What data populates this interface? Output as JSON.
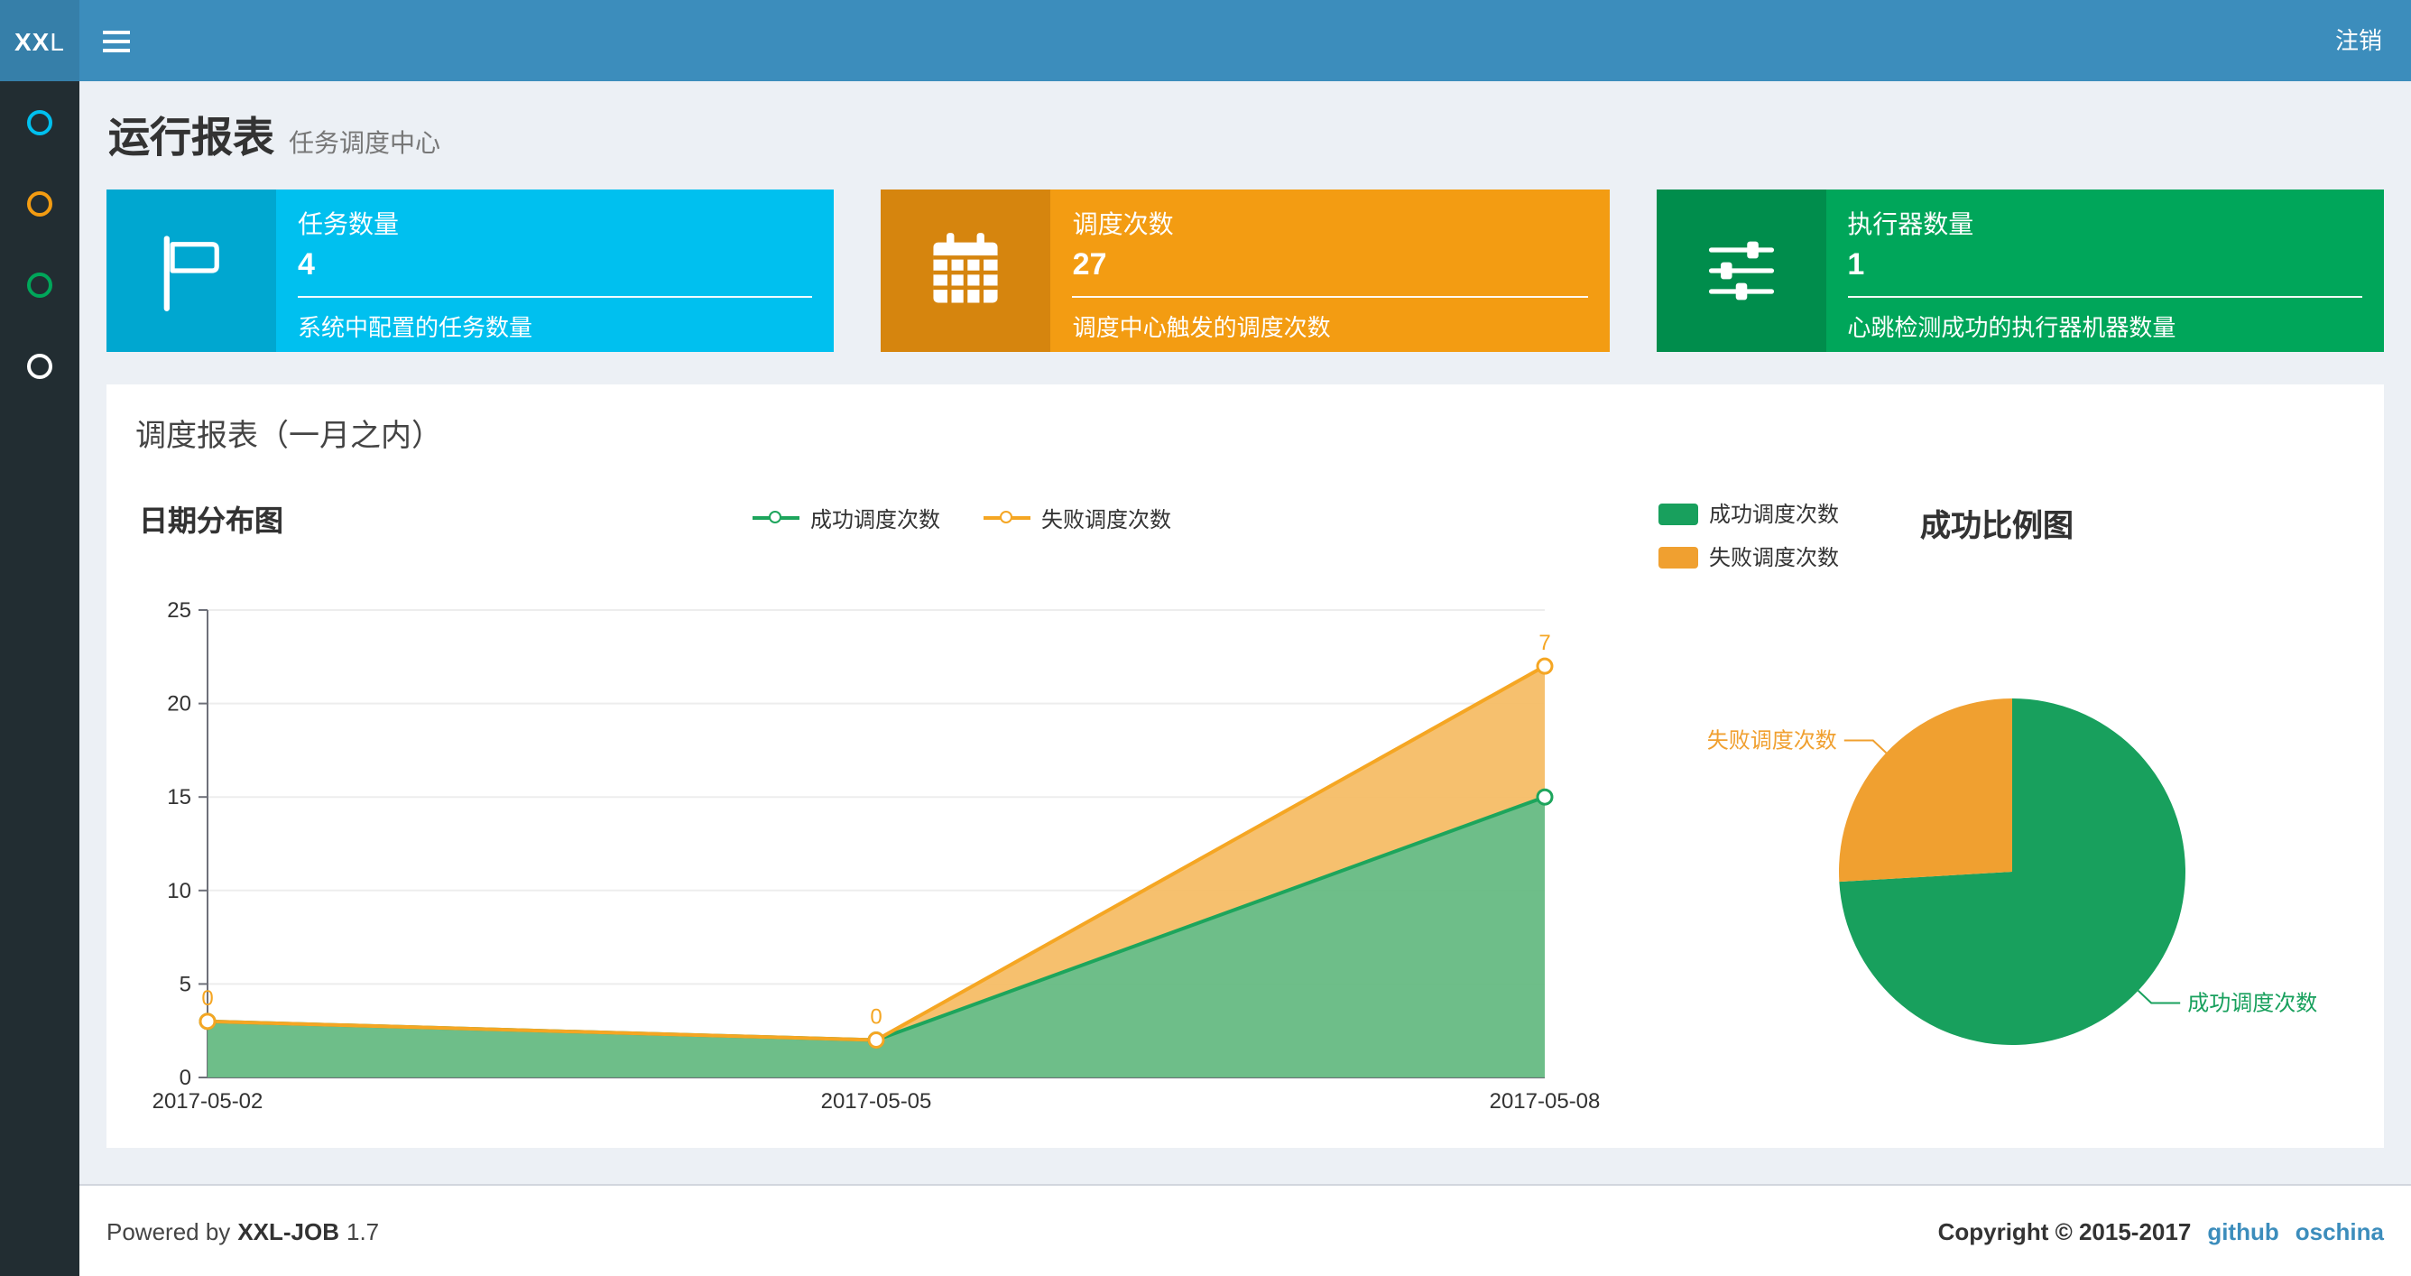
{
  "theme": {
    "navbar_bg": "#3c8dbc",
    "logo_bg": "#367fa9",
    "sidebar_bg": "#222d32",
    "content_bg": "#ecf0f5",
    "link_color": "#3c8dbc"
  },
  "navbar": {
    "logo_bold": "XX",
    "logo_light": "L",
    "logout_label": "注销"
  },
  "sidebar": {
    "items": [
      {
        "name": "menu-dot-1",
        "color": "#00c0ef"
      },
      {
        "name": "menu-dot-2",
        "color": "#f39c12"
      },
      {
        "name": "menu-dot-3",
        "color": "#00a65a"
      },
      {
        "name": "menu-dot-4",
        "color": "#ffffff"
      }
    ]
  },
  "page_header": {
    "title": "运行报表",
    "subtitle": "任务调度中心"
  },
  "info_boxes": [
    {
      "label": "任务数量",
      "value": "4",
      "desc": "系统中配置的任务数量",
      "bg": "#00c0ef",
      "icon_bg": "#00a7d0",
      "icon": "flag-icon"
    },
    {
      "label": "调度次数",
      "value": "27",
      "desc": "调度中心触发的调度次数",
      "bg": "#f39c12",
      "icon_bg": "#d6850e",
      "icon": "calendar-icon"
    },
    {
      "label": "执行器数量",
      "value": "1",
      "desc": "心跳检测成功的执行器机器数量",
      "bg": "#00a65a",
      "icon_bg": "#008d4c",
      "icon": "sliders-icon"
    }
  ],
  "panel": {
    "title": "调度报表（一月之内）"
  },
  "chart_data": [
    {
      "type": "area",
      "title": "日期分布图",
      "x": [
        "2017-05-02",
        "2017-05-05",
        "2017-05-08"
      ],
      "series": [
        {
          "name": "成功调度次数",
          "values": [
            3,
            2,
            15
          ],
          "color": "#1da55c",
          "fill": "#66bb83",
          "show_labels": false
        },
        {
          "name": "失败调度次数",
          "values": [
            0,
            0,
            7
          ],
          "color": "#f5a623",
          "fill": "#f5bd66",
          "show_labels": true
        }
      ],
      "stacked": true,
      "ylim": [
        0,
        25
      ],
      "yticks": [
        0,
        5,
        10,
        15,
        20,
        25
      ],
      "grid": true,
      "legend_position": "top-center"
    },
    {
      "type": "pie",
      "title": "成功比例图",
      "slices": [
        {
          "name": "成功调度次数",
          "value": 20,
          "color": "#18a05d"
        },
        {
          "name": "失败调度次数",
          "value": 7,
          "color": "#f0a030"
        }
      ],
      "legend_position": "top-left",
      "start_angle": "top",
      "clockwise": true
    }
  ],
  "footer": {
    "powered_by": "Powered by",
    "product": "XXL-JOB",
    "version": "1.7",
    "copyright": "Copyright © 2015-2017",
    "links": [
      {
        "label": "github"
      },
      {
        "label": "oschina"
      }
    ]
  }
}
